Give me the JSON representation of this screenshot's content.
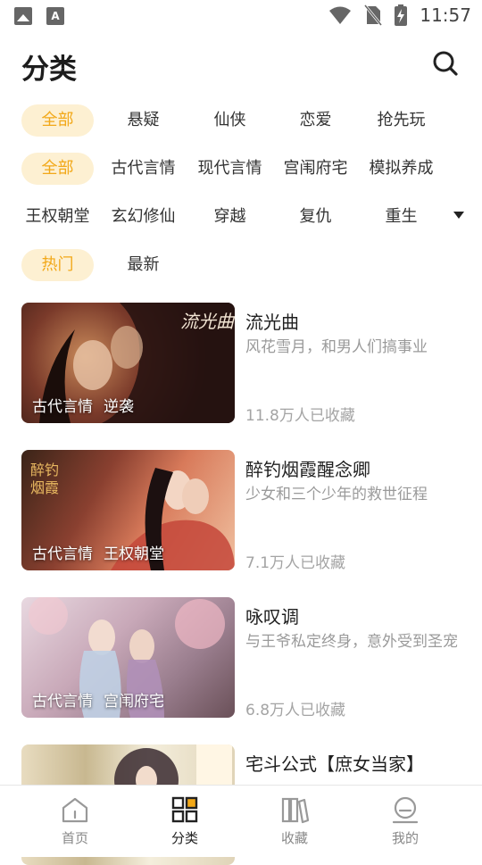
{
  "status_bar": {
    "time": "11:57",
    "notif_a": "A"
  },
  "header": {
    "title": "分类"
  },
  "filters": {
    "type_row": [
      "全部",
      "悬疑",
      "仙侠",
      "恋爱",
      "抢先玩"
    ],
    "genre_row1": [
      "全部",
      "古代言情",
      "现代言情",
      "宫闱府宅",
      "模拟养成"
    ],
    "genre_row2": [
      "王权朝堂",
      "玄幻修仙",
      "穿越",
      "复仇",
      "重生"
    ],
    "sort_row": [
      "热门",
      "最新"
    ]
  },
  "books": [
    {
      "title": "流光曲",
      "desc": "风花雪月，和男人们搞事业",
      "count": "11.8万人已收藏",
      "tags": [
        "古代言情",
        "逆袭"
      ]
    },
    {
      "title": "醉钓烟霞醒念卿",
      "desc": "少女和三个少年的救世征程",
      "count": "7.1万人已收藏",
      "tags": [
        "古代言情",
        "王权朝堂"
      ]
    },
    {
      "title": "咏叹调",
      "desc": "与王爷私定终身，意外受到圣宠",
      "count": "6.8万人已收藏",
      "tags": [
        "古代言情",
        "宫闱府宅"
      ]
    },
    {
      "title": "宅斗公式【庶女当家】",
      "desc": "",
      "count": "",
      "tags": []
    }
  ],
  "bottom_nav": [
    {
      "label": "首页",
      "icon": "home-icon"
    },
    {
      "label": "分类",
      "icon": "category-icon"
    },
    {
      "label": "收藏",
      "icon": "bookshelf-icon"
    },
    {
      "label": "我的",
      "icon": "profile-icon"
    }
  ],
  "colors": {
    "accent": "#f2a818",
    "accent_bg": "#fdf0d2",
    "muted": "#9a9a9a"
  }
}
